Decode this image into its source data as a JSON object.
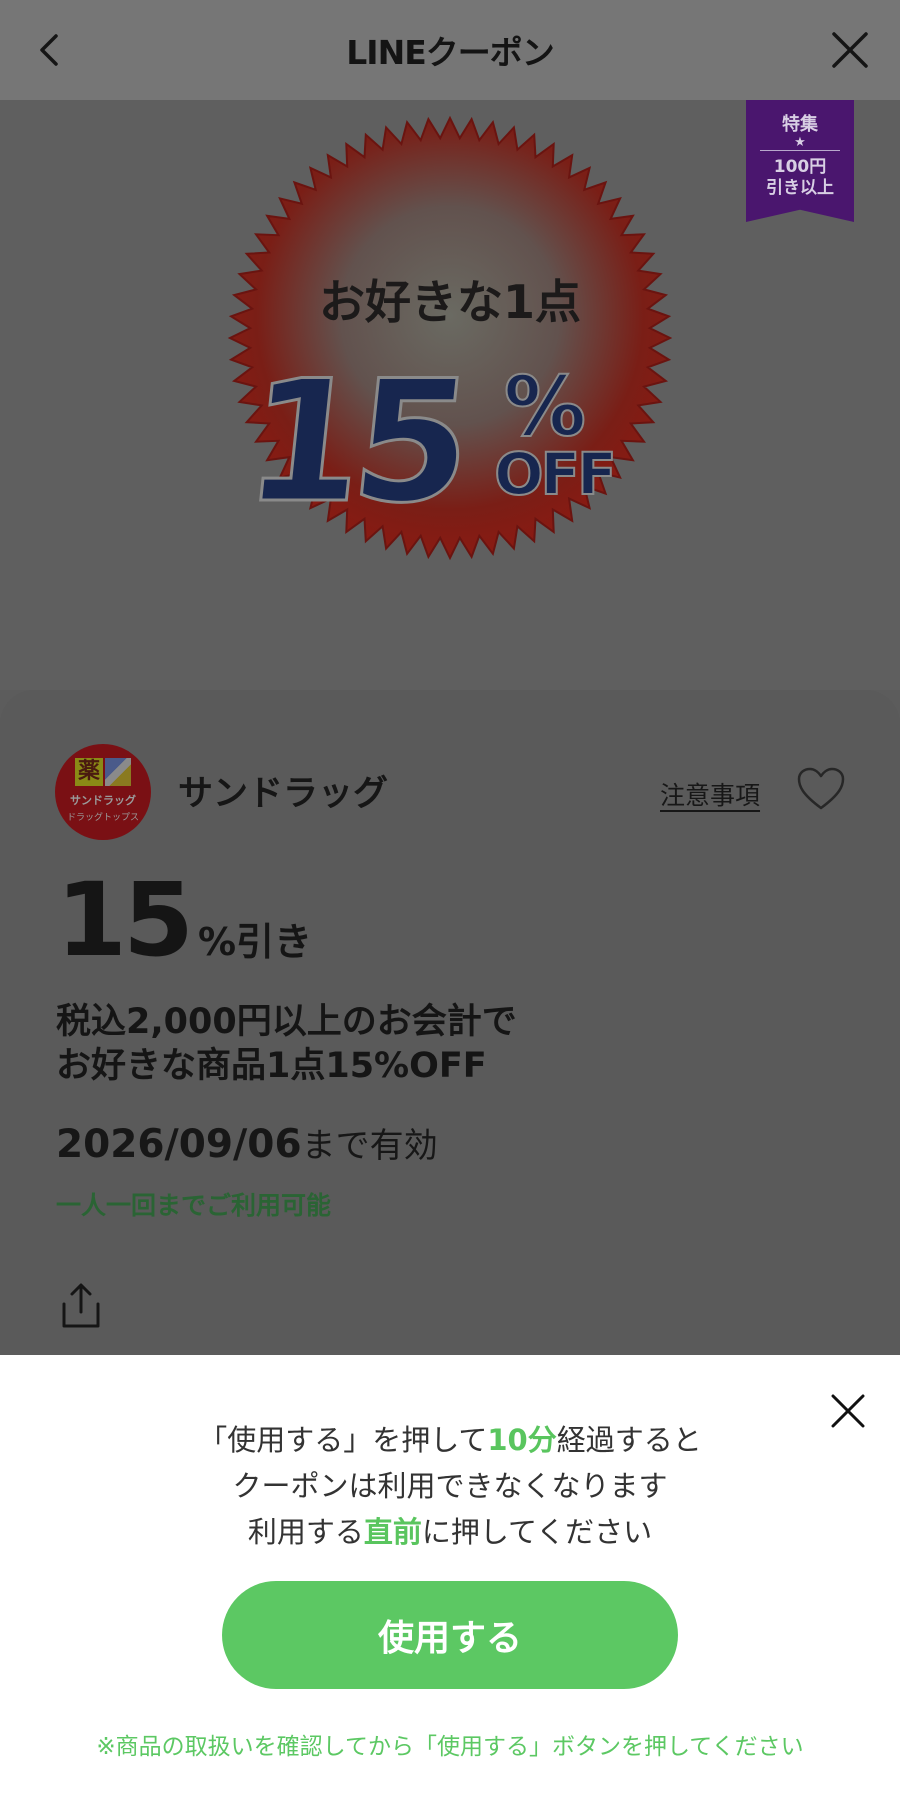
{
  "header": {
    "title": "LINEクーポン",
    "back_icon": "chevron-left-icon",
    "close_icon": "close-icon"
  },
  "hero": {
    "ribbon": {
      "line1": "特集",
      "star": "★",
      "line2": "100円",
      "line3": "引き以上"
    },
    "badge": {
      "top_text": "お好きな1点",
      "big_number": "15",
      "percent": "%",
      "off": "OFF"
    }
  },
  "store": {
    "name": "サンドラッグ",
    "logo_kanji": "薬",
    "logo_text1": "サンドラッグ",
    "logo_text2": "ドラッグトップス",
    "notes_label": "注意事項"
  },
  "coupon": {
    "discount_value": "15",
    "discount_unit": "%引き",
    "description_line1": "税込2,000円以上のお会計で",
    "description_line2": "お好きな商品1点15%OFF",
    "expiry_date": "2026/09/06",
    "expiry_suffix": "まで有効",
    "usage_limit": "一人一回までご利用可能"
  },
  "sheet": {
    "msg_line1_a": "「使用する」を押して",
    "msg_line1_hl": "10分",
    "msg_line1_b": "経過すると",
    "msg_line2": "クーポンは利用できなくなります",
    "msg_line3_a": "利用する",
    "msg_line3_hl": "直前",
    "msg_line3_b": "に押してください",
    "use_button": "使用する",
    "note": "※商品の取扱いを確認してから「使用する」ボタンを押してください"
  },
  "colors": {
    "accent_green": "#5cc863",
    "ribbon_purple": "#4a166e",
    "badge_red": "#8a1a14",
    "badge_blue": "#17264f"
  }
}
